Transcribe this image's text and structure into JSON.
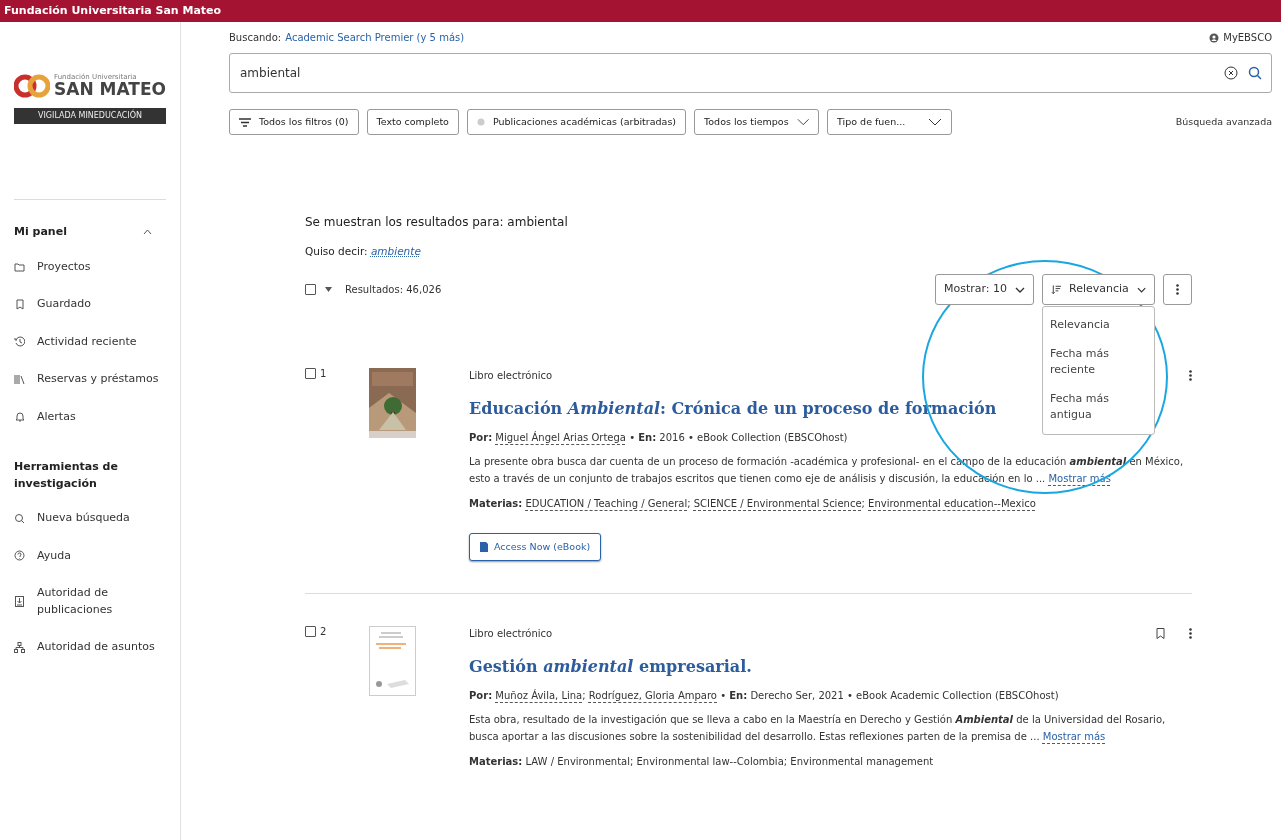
{
  "header": {
    "title": "Fundación Universitaria San Mateo"
  },
  "sidebar": {
    "logo": {
      "small": "Fundación Universitaria",
      "big": "SAN MATEO",
      "band": "VIGILADA MINEDUCACIÓN"
    },
    "sections": [
      {
        "title": "Mi panel",
        "expanded": true,
        "items": [
          {
            "label": "Proyectos"
          },
          {
            "label": "Guardado"
          },
          {
            "label": "Actividad reciente"
          },
          {
            "label": "Reservas y préstamos"
          },
          {
            "label": "Alertas"
          }
        ]
      },
      {
        "title": "Herramientas de investigación",
        "items": [
          {
            "label": "Nueva búsqueda"
          },
          {
            "label": "Ayuda"
          },
          {
            "label": "Autoridad de publicaciones"
          },
          {
            "label": "Autoridad de asuntos"
          }
        ]
      }
    ]
  },
  "search": {
    "label": "Buscando:",
    "databases": "Academic Search Premier (y 5 más)",
    "account": "MyEBSCO",
    "query": "ambiental",
    "advanced": "Búsqueda avanzada",
    "filters": [
      {
        "label": "Todos los filtros (0)",
        "kind": "filters"
      },
      {
        "label": "Texto completo",
        "kind": "plain"
      },
      {
        "label": "Publicaciones académicas (arbitradas)",
        "kind": "toggle"
      },
      {
        "label": "Todos los tiempos",
        "kind": "dropdown"
      },
      {
        "label": "Tipo de fuen...",
        "kind": "dropdown"
      }
    ]
  },
  "results": {
    "showing": "Se muestran los resultados para: ambiental",
    "did_you_mean_label": "Quiso decir:",
    "did_you_mean": "ambiente",
    "all_selected": false,
    "count": "Resultados: 46,026",
    "page_size": "Mostrar: 10",
    "sort": "Relevancia",
    "sort_menu": {
      "open": true,
      "options": [
        "Relevancia",
        "Fecha más reciente",
        "Fecha más antigua"
      ]
    },
    "annotation_circle": true,
    "items": [
      {
        "number": "1",
        "selected": false,
        "type": "Libro electrónico",
        "title": "Educación *Ambiental*: Crónica de un proceso de formación",
        "by_label": "Por:",
        "authors": [
          "Miguel Ángel Arias Ortega"
        ],
        "separator": "•",
        "in_label": "En:",
        "source": "2016 • eBook Collection (EBSCOhost)",
        "abstract": "La presente obra busca dar cuenta de un proceso de formación -académica y profesional- en el campo de la educación **ambiental** en México, esto a través de un conjunto de trabajos escritos que tienen como eje de análisis y discusión, la educación en lo ...",
        "more": "Mostrar más",
        "subjects_label": "Materias:",
        "subjects": [
          "EDUCATION / Teaching / General",
          "SCIENCE / Environmental Science",
          "Environmental education--Mexico"
        ],
        "list_separator": ";",
        "subjects_linked": true,
        "access": "Access Now (eBook)",
        "saved_icon": false
      },
      {
        "number": "2",
        "selected": false,
        "type": "Libro electrónico",
        "title": "Gestión *ambiental* empresarial.",
        "by_label": "Por:",
        "authors": [
          "Muñoz Ávila, Lina",
          "Rodríguez, Gloria Amparo"
        ],
        "separator": "•",
        "in_label": "En:",
        "source": "Derecho Ser, 2021 • eBook Academic Collection (EBSCOhost)",
        "abstract": "Esta obra, resultado de la investigación que se lleva a cabo en la Maestría en Derecho y Gestión **Ambiental** de la Universidad del Rosario, busca aportar a las discusiones sobre la sostenibilidad del desarrollo. Estas reflexiones parten de la premisa de ...",
        "more": "Mostrar más",
        "subjects_label": "Materias:",
        "subjects": [
          "LAW / Environmental",
          "Environmental law--Colombia",
          "Environmental management"
        ],
        "list_separator": ";",
        "subjects_linked": false,
        "saved_icon": true
      }
    ]
  }
}
